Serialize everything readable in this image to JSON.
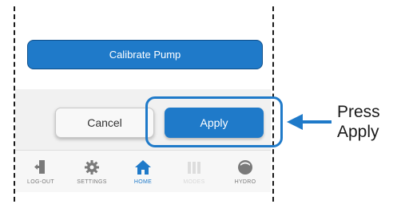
{
  "calibrate_button": {
    "label": "Calibrate Pump"
  },
  "actions": {
    "cancel_label": "Cancel",
    "apply_label": "Apply"
  },
  "tabs": [
    {
      "label": "LOG-OUT",
      "icon": "logout-icon"
    },
    {
      "label": "SETTINGS",
      "icon": "gear-icon"
    },
    {
      "label": "HOME",
      "icon": "home-icon"
    },
    {
      "label": "MODES",
      "icon": "modes-icon"
    },
    {
      "label": "HYDRO",
      "icon": "hydro-icon"
    }
  ],
  "active_tab": "HOME",
  "disabled_tab": "MODES",
  "callout": {
    "line1": "Press",
    "line2": "Apply"
  },
  "colors": {
    "accent": "#1f7ac9",
    "tab_inactive": "#7a7a7a",
    "tab_disabled": "#d8d8d8"
  }
}
